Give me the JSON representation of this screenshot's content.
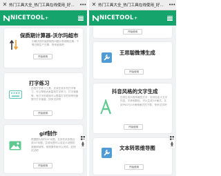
{
  "left": {
    "tab_title": "热门工具大全_热门工具在线使用_好...",
    "logo": "NICETOOL",
    "cards": [
      {
        "title": "保质期计算器-沃尔玛超市",
        "desc": "中解决您的保质期的问题计算到期日期，下等日期生产日期，快来使用吧",
        "button": "开始使用"
      },
      {
        "title": "打字练习",
        "desc": "在线打字练习工具，支持在线手写打字等习，可以帮助大家高效打字练习，打字速度等，有打字的烦恼可以提高打字的效率快速提升打字速度，快来试试吧",
        "button": "开始使用"
      },
      {
        "title": "gif制作",
        "desc": "根据图片制作GIF动图，支持在线多图合成GIF动图，生成动图可以自定义动图的速度和帧率，常规操作就可以完成，赶快试试吧",
        "button": "开始使用"
      }
    ]
  },
  "right": {
    "tab_title": "热门工具大全_热门工具在线使用_好...",
    "logo": "NICETOOL",
    "cards": [
      {
        "title": "",
        "desc": "",
        "button": "开始使用"
      },
      {
        "title": "王思聪微博生成",
        "desc": "",
        "button": "开始使用"
      },
      {
        "title": "抖音风格的文字生成",
        "desc": "在线生成抖音风格的文字，支持自定义文字内容，字体和颜色，可以生成GIF格式，支持PNG与GIF两种格式的下载，快来试试吧",
        "button": "开始使用"
      },
      {
        "title": "文本转思维导图",
        "desc": "",
        "button": "开始使用"
      }
    ]
  },
  "colors": {
    "brand_green": "#14a46c",
    "background": "#f1f2f4"
  },
  "icons": [
    "close-icon",
    "more-icon",
    "menu-icon",
    "sort-arrows-icon",
    "keyboard-icon",
    "image-icon",
    "wrench-icon",
    "letter-a-icon",
    "qrcode-icon",
    "rocket-icon"
  ]
}
